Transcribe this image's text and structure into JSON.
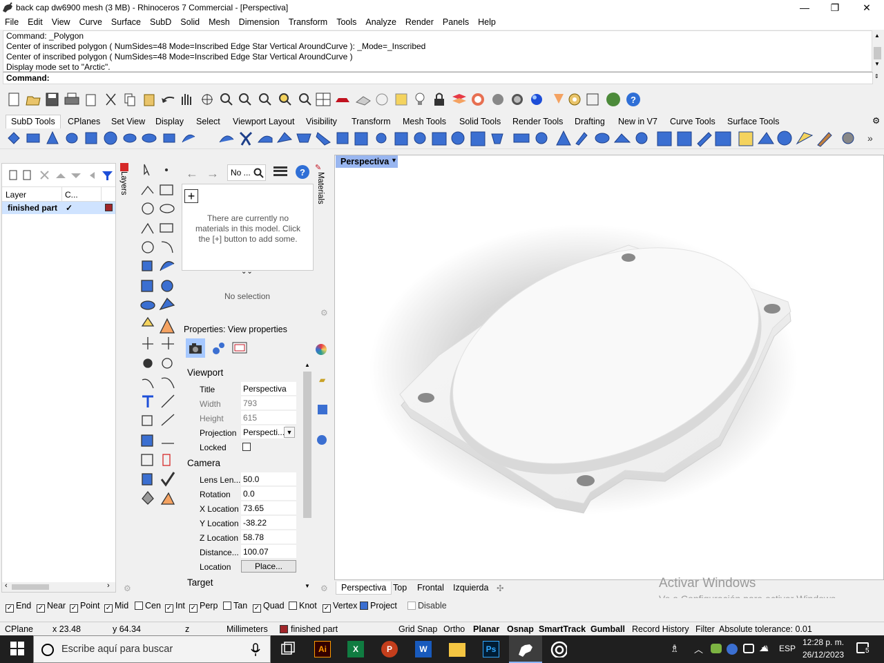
{
  "window": {
    "title": "back cap dw6900 mesh (3 MB) - Rhinoceros 7 Commercial - [Perspectiva]",
    "minimize": "—",
    "restore": "❐",
    "close": "✕"
  },
  "menu": [
    "File",
    "Edit",
    "View",
    "Curve",
    "Surface",
    "SubD",
    "Solid",
    "Mesh",
    "Dimension",
    "Transform",
    "Tools",
    "Analyze",
    "Render",
    "Panels",
    "Help"
  ],
  "command": {
    "history": [
      "Command: _Polygon",
      "Center of inscribed polygon ( NumSides=48  Mode=Inscribed  Edge  Star  Vertical  AroundCurve ): _Mode=_Inscribed",
      "Center of inscribed polygon ( NumSides=48  Mode=Inscribed  Edge  Star  Vertical  AroundCurve )",
      "Display mode set to \"Arctic\"."
    ],
    "prompt": "Command:"
  },
  "toolbar_tabs": [
    "SubD Tools",
    "CPlanes",
    "Set View",
    "Display",
    "Select",
    "Viewport Layout",
    "Visibility",
    "Transform",
    "Mesh Tools",
    "Solid Tools",
    "Render Tools",
    "Drafting",
    "New in V7",
    "Curve Tools",
    "Surface Tools"
  ],
  "layers": {
    "tab_label": "Layers",
    "col_layer": "Layer",
    "col_current": "C...",
    "rows": [
      {
        "name": "finished part",
        "current": "✓",
        "color": "#a0262a"
      }
    ]
  },
  "materials": {
    "tab_label": "Materials",
    "search_placeholder": "No ...",
    "empty_message": "There are currently no materials in this model. Click the [+] button to add some.",
    "no_selection": "No selection"
  },
  "properties": {
    "header": "Properties: View properties",
    "sections": {
      "viewport": "Viewport",
      "camera": "Camera",
      "target": "Target"
    },
    "viewport_rows": [
      {
        "label": "Title",
        "value": "Perspectiva"
      },
      {
        "label": "Width",
        "value": "793"
      },
      {
        "label": "Height",
        "value": "615"
      },
      {
        "label": "Projection",
        "value": "Perspecti..."
      },
      {
        "label": "Locked",
        "value": ""
      }
    ],
    "camera_rows": [
      {
        "label": "Lens Len...",
        "value": "50.0"
      },
      {
        "label": "Rotation",
        "value": "0.0"
      },
      {
        "label": "X Location",
        "value": "73.65"
      },
      {
        "label": "Y Location",
        "value": "-38.22"
      },
      {
        "label": "Z Location",
        "value": "58.78"
      },
      {
        "label": "Distance...",
        "value": "100.07"
      },
      {
        "label": "Location",
        "value": "Place..."
      }
    ]
  },
  "viewport": {
    "active_title": "Perspectiva",
    "tabs": [
      "Perspectiva",
      "Top",
      "Frontal",
      "Izquierda"
    ],
    "add_tab": "✣",
    "watermark_title": "Activar Windows",
    "watermark_sub": "Ve a Configuración para activar Windows."
  },
  "osnaps": [
    {
      "label": "End",
      "checked": true
    },
    {
      "label": "Near",
      "checked": true
    },
    {
      "label": "Point",
      "checked": true
    },
    {
      "label": "Mid",
      "checked": true
    },
    {
      "label": "Cen",
      "checked": false
    },
    {
      "label": "Int",
      "checked": true
    },
    {
      "label": "Perp",
      "checked": true
    },
    {
      "label": "Tan",
      "checked": false
    },
    {
      "label": "Quad",
      "checked": true
    },
    {
      "label": "Knot",
      "checked": false
    },
    {
      "label": "Vertex",
      "checked": true
    },
    {
      "label": "Project",
      "checked": true
    },
    {
      "label": "Disable",
      "checked": false
    }
  ],
  "status": {
    "cplane": "CPlane",
    "x": "x 23.48",
    "y": "y 64.34",
    "z": "z",
    "units": "Millimeters",
    "layer": "finished part",
    "grid_snap": "Grid Snap",
    "ortho": "Ortho",
    "planar": "Planar",
    "osnap": "Osnap",
    "smarttrack": "SmartTrack",
    "gumball": "Gumball",
    "record_history": "Record History",
    "filter": "Filter",
    "tolerance": "Absolute tolerance: 0.01"
  },
  "taskbar": {
    "search_placeholder": "Escribe aquí para buscar",
    "lang": "ESP",
    "time": "12:28 p. m.",
    "date": "26/12/2023",
    "notif_count": "5"
  }
}
